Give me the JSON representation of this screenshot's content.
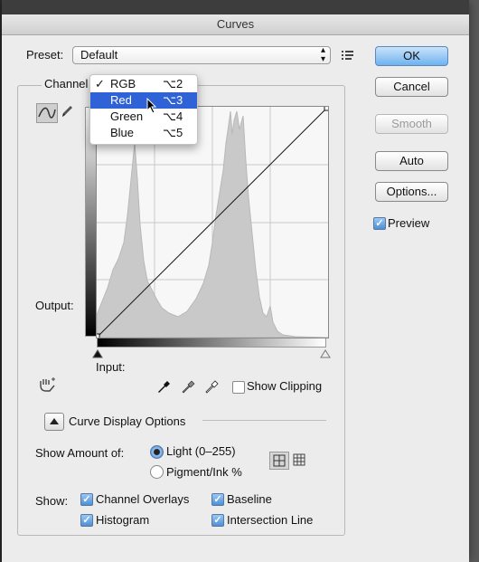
{
  "window": {
    "title": "Curves"
  },
  "preset": {
    "label": "Preset:",
    "value": "Default"
  },
  "buttons": {
    "ok": "OK",
    "cancel": "Cancel",
    "smooth": "Smooth",
    "auto": "Auto",
    "options": "Options..."
  },
  "preview": {
    "label": "Preview",
    "checked": true
  },
  "channel": {
    "label": "Channel",
    "selected": "RGB"
  },
  "channel_menu": [
    {
      "check": "✓",
      "label": "RGB",
      "shortcut": "⌥2"
    },
    {
      "check": "",
      "label": "Red",
      "shortcut": "⌥3"
    },
    {
      "check": "",
      "label": "Green",
      "shortcut": "⌥4"
    },
    {
      "check": "",
      "label": "Blue",
      "shortcut": "⌥5"
    }
  ],
  "graph": {
    "output_label": "Output:",
    "input_label": "Input:"
  },
  "show_clipping": {
    "label": "Show Clipping",
    "checked": false
  },
  "curve_display_options": {
    "label": "Curve Display Options"
  },
  "show_amount": {
    "label": "Show Amount of:",
    "light": "Light  (0–255)",
    "pigment": "Pigment/Ink %",
    "selected": "light"
  },
  "show": {
    "label": "Show:",
    "channel_overlays": "Channel Overlays",
    "baseline": "Baseline",
    "histogram": "Histogram",
    "intersection_line": "Intersection Line"
  },
  "icons": {
    "menu": "list-menu-icon",
    "curve_tool": "curve-tool-icon",
    "pencil": "pencil-icon",
    "hand": "on-image-adjust-icon",
    "eyedroppers": [
      "black-point-eyedropper-icon",
      "gray-point-eyedropper-icon",
      "white-point-eyedropper-icon"
    ],
    "grid_coarse": "grid-4x4-icon",
    "grid_fine": "grid-10x10-icon",
    "disclosure": "disclosure-triangle-icon"
  }
}
